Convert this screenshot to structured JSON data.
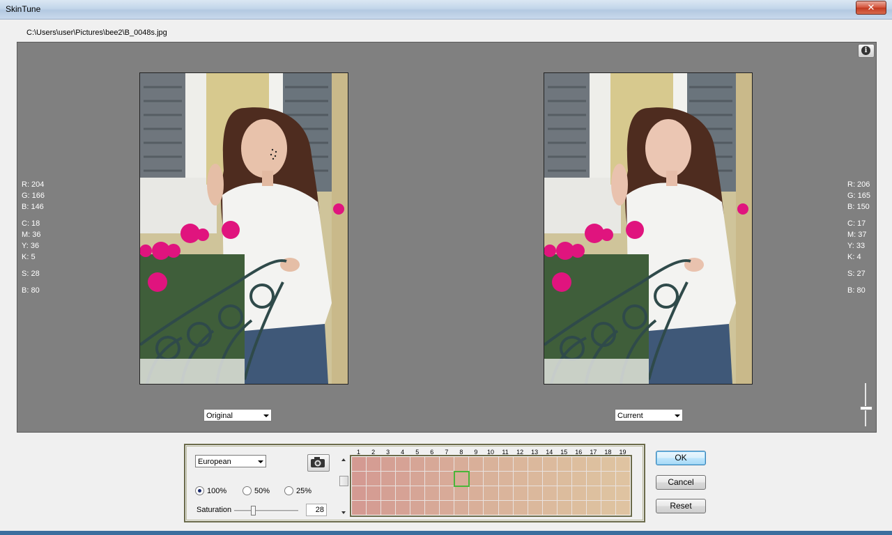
{
  "window": {
    "title": "SkinTune",
    "close_glyph": "✕"
  },
  "file_path": "C:\\Users\\user\\Pictures\\bee2\\B_0048s.jpg",
  "info_button": {
    "glyph": "i"
  },
  "left_readout": {
    "r": "R: 204",
    "g": "G: 166",
    "b": "B: 146",
    "c": "C:   18",
    "m": "M:   36",
    "y": "Y:   36",
    "k": "K:    5",
    "s": "S:   28",
    "br": "B:   80"
  },
  "right_readout": {
    "r": "R: 206",
    "g": "G: 165",
    "b": "B: 150",
    "c": "C:   17",
    "m": "M:   37",
    "y": "Y:   33",
    "k": "K:    4",
    "s": "S:   27",
    "br": "B:   80"
  },
  "left_view_select": {
    "value": "Original"
  },
  "right_view_select": {
    "value": "Current"
  },
  "panel": {
    "ethnicity_select": {
      "value": "European"
    },
    "radios": [
      {
        "label": "100%",
        "checked": true
      },
      {
        "label": "50%",
        "checked": false
      },
      {
        "label": "25%",
        "checked": false
      }
    ],
    "saturation_label": "Saturation",
    "saturation_value": "28",
    "saturation_level": 0.28,
    "grid": {
      "columns": [
        "1",
        "2",
        "3",
        "4",
        "5",
        "6",
        "7",
        "8",
        "9",
        "10",
        "11",
        "12",
        "13",
        "14",
        "15",
        "16",
        "17",
        "18",
        "19"
      ],
      "rows": 4,
      "selected": {
        "col": 8,
        "row": 2
      }
    }
  },
  "buttons": {
    "ok": "OK",
    "cancel": "Cancel",
    "reset": "Reset"
  },
  "icons": {
    "camera": "camera-icon",
    "info": "info-icon",
    "dropdown": "chevron-down-icon"
  }
}
